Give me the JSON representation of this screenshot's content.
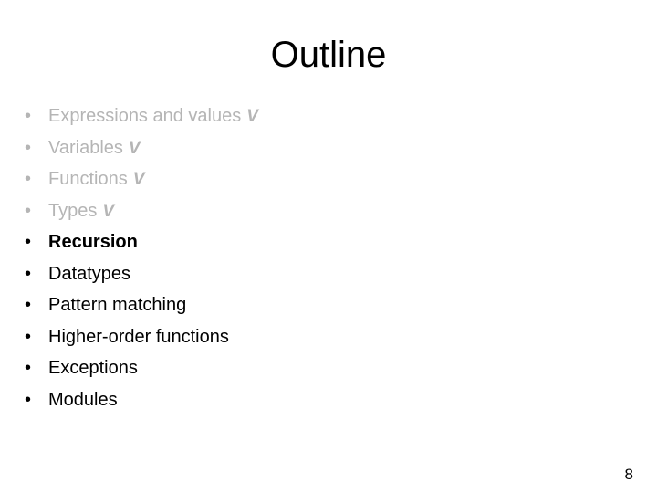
{
  "slide": {
    "title": "Outline",
    "bullet_glyph": "•",
    "page_number": "8",
    "colors": {
      "background": "#ffffff",
      "text": "#000000",
      "done_text": "#b5b5b5"
    },
    "items": [
      {
        "label": "Expressions and values",
        "check": "V",
        "state": "done"
      },
      {
        "label": "Variables",
        "check": "V",
        "state": "done"
      },
      {
        "label": "Functions",
        "check": "V",
        "state": "done"
      },
      {
        "label": "Types",
        "check": "V",
        "state": "done"
      },
      {
        "label": "Recursion",
        "check": "",
        "state": "current"
      },
      {
        "label": "Datatypes",
        "check": "",
        "state": "pending"
      },
      {
        "label": "Pattern matching",
        "check": "",
        "state": "pending"
      },
      {
        "label": "Higher-order functions",
        "check": "",
        "state": "pending"
      },
      {
        "label": "Exceptions",
        "check": "",
        "state": "pending"
      },
      {
        "label": "Modules",
        "check": "",
        "state": "pending"
      }
    ]
  }
}
